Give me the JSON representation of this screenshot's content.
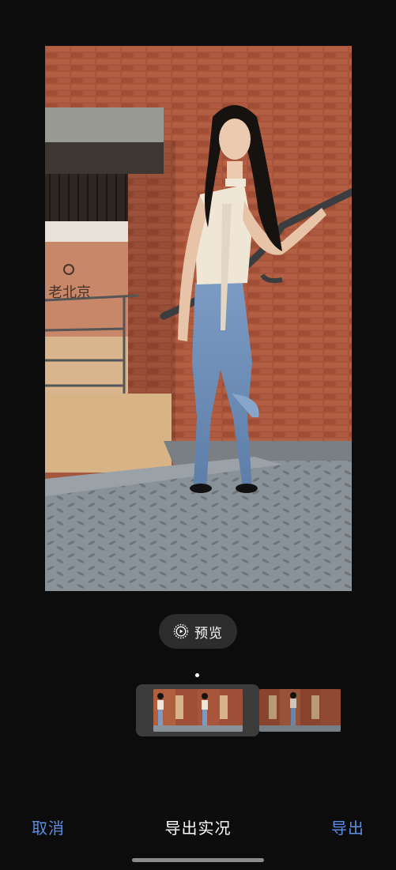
{
  "editor": {
    "title": "导出实况",
    "cancel_label": "取消",
    "export_label": "导出"
  },
  "preview": {
    "label": "预览",
    "icon": "live-photo-play-icon"
  },
  "photo": {
    "sign_text": "老北京",
    "description": "woman in white halter top and jeans on metal stairs by red brick wall"
  },
  "filmstrip": {
    "selected_frames": 4,
    "other_frames": 4,
    "position_indicator": "dot"
  },
  "colors": {
    "background": "#0c0c0c",
    "accent": "#5c8ee6",
    "pill": "#2d2d2d",
    "selected_frame_bg": "#3c3c3c"
  }
}
